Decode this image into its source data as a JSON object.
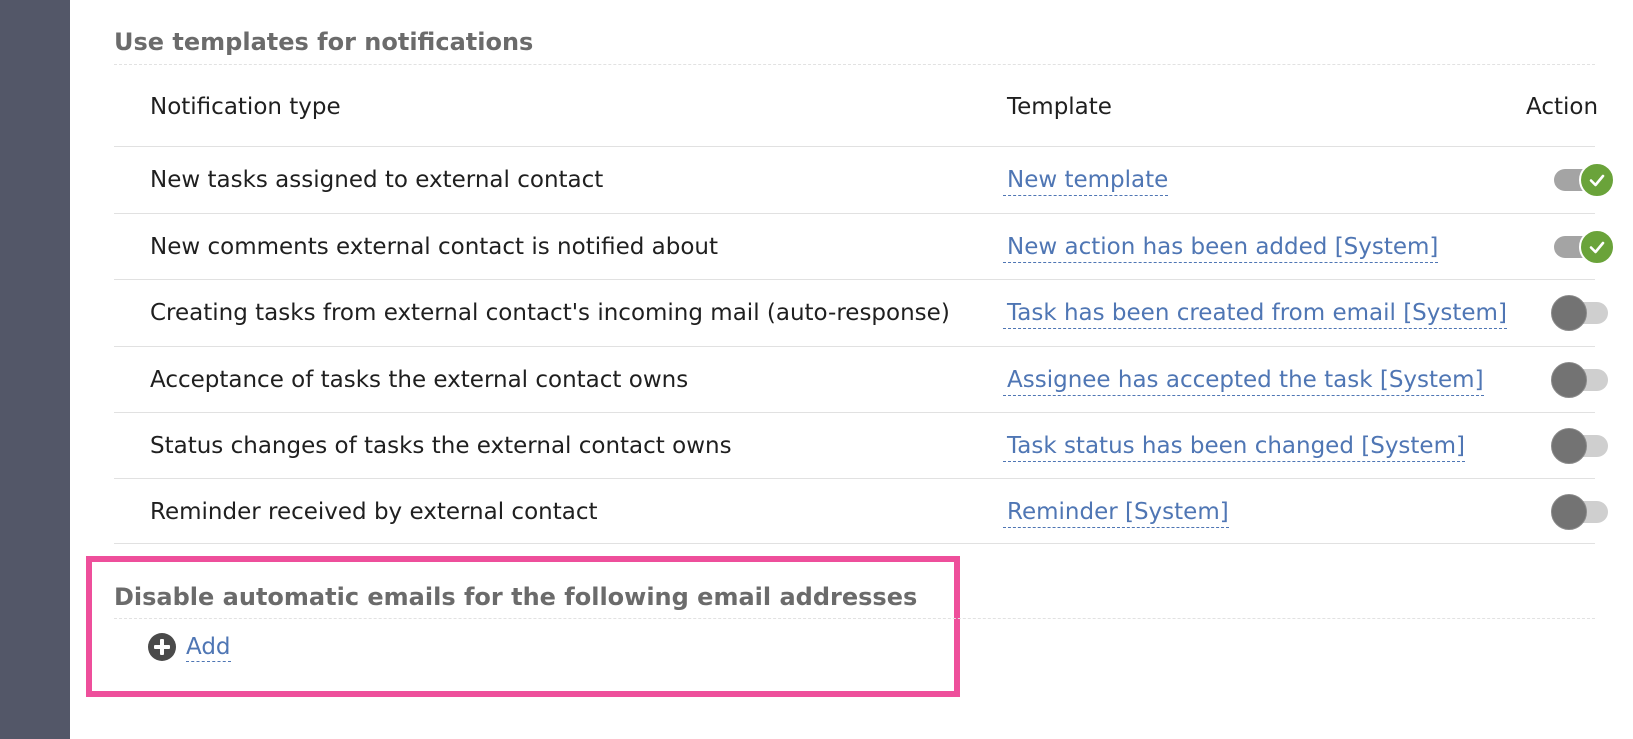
{
  "templates_section": {
    "title": "Use templates for notifications",
    "columns": {
      "notification_type": "Notification type",
      "template": "Template",
      "action": "Action"
    },
    "rows": [
      {
        "type": "New tasks assigned to external contact",
        "template": "New template",
        "enabled": true
      },
      {
        "type": "New comments external contact is notified about",
        "template": "New action has been added [System]",
        "enabled": true
      },
      {
        "type": "Creating tasks from external contact's incoming mail (auto-response)",
        "template": "Task has been created from email [System]",
        "enabled": false
      },
      {
        "type": "Acceptance of tasks the external contact owns",
        "template": "Assignee has accepted the task [System]",
        "enabled": false
      },
      {
        "type": "Status changes of tasks the external contact owns",
        "template": "Task status has been changed [System]",
        "enabled": false
      },
      {
        "type": "Reminder received by external contact",
        "template": "Reminder [System]",
        "enabled": false
      }
    ]
  },
  "disable_section": {
    "title": "Disable automatic emails for the following email addresses",
    "add_label": "Add"
  },
  "colors": {
    "sidebar": "#535768",
    "link": "#4f76b4",
    "toggle_on": "#6aa33a",
    "highlight": "#ee4f9b"
  }
}
